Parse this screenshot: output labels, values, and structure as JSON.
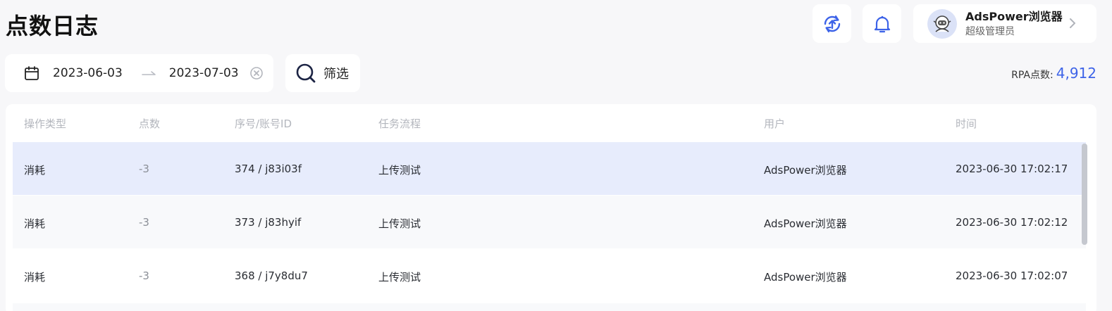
{
  "page": {
    "title": "点数日志"
  },
  "user": {
    "name": "AdsPower浏览器",
    "role": "超级管理员"
  },
  "date_range": {
    "start": "2023-06-03",
    "end": "2023-07-03"
  },
  "filter": {
    "label": "筛选"
  },
  "points": {
    "label": "RPA点数:",
    "value": "4,912"
  },
  "table": {
    "headers": {
      "type": "操作类型",
      "points": "点数",
      "id": "序号/账号ID",
      "flow": "任务流程",
      "user": "用户",
      "time": "时间"
    },
    "rows": [
      {
        "type": "消耗",
        "points": "-3",
        "id": "374 / j83i03f",
        "flow": "上传测试",
        "user": "AdsPower浏览器",
        "time": "2023-06-30 17:02:17"
      },
      {
        "type": "消耗",
        "points": "-3",
        "id": "373 / j83hyif",
        "flow": "上传测试",
        "user": "AdsPower浏览器",
        "time": "2023-06-30 17:02:12"
      },
      {
        "type": "消耗",
        "points": "-3",
        "id": "368 / j7y8du7",
        "flow": "上传测试",
        "user": "AdsPower浏览器",
        "time": "2023-06-30 17:02:07"
      }
    ]
  },
  "icons": {
    "sync": "sync-upload-icon",
    "bell": "bell-icon",
    "avatar": "astronaut-avatar-icon",
    "chevron": "chevron-right-icon",
    "calendar": "calendar-icon",
    "arrow": "arrow-right-icon",
    "clear": "clear-icon",
    "search": "search-icon"
  },
  "colors": {
    "accent": "#3d63e8",
    "selected_row": "#e7ecfc"
  }
}
